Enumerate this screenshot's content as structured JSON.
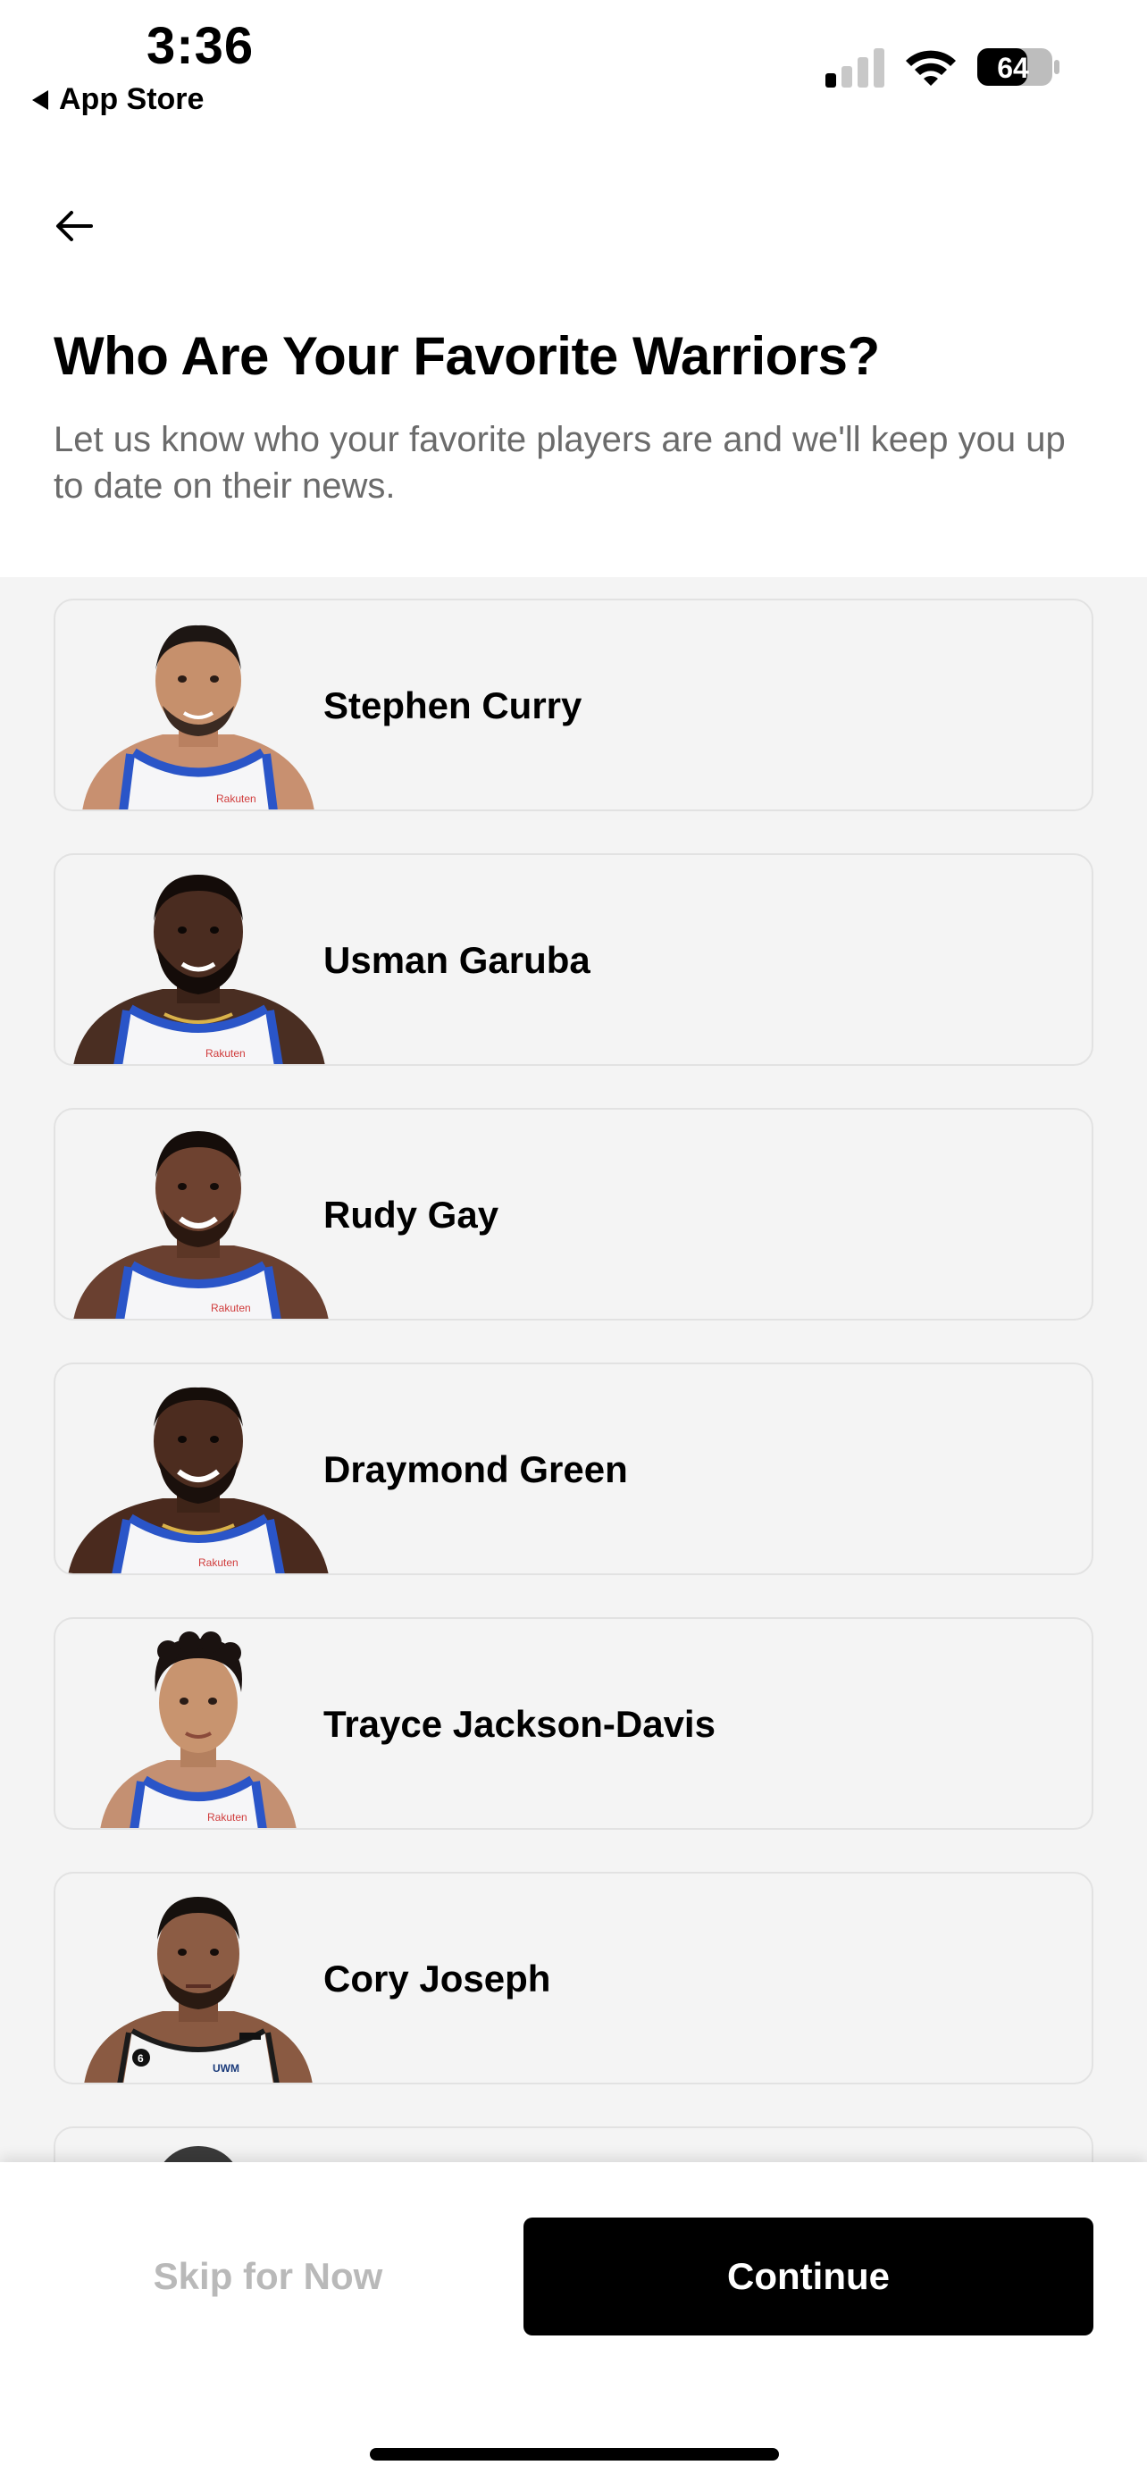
{
  "status_bar": {
    "time": "3:36",
    "back_app_label": "App Store",
    "battery_level": "64",
    "signal_bars_active": 1,
    "signal_bars_total": 4
  },
  "header": {
    "back_icon": "arrow-left-icon",
    "title": "Who Are Your Favorite Warriors?",
    "subtitle": "Let us know who your favorite players are and we'll keep you up to date on their news."
  },
  "players": [
    {
      "name": "Stephen Curry",
      "jersey": "white"
    },
    {
      "name": "Usman Garuba",
      "jersey": "white"
    },
    {
      "name": "Rudy Gay",
      "jersey": "white"
    },
    {
      "name": "Draymond Green",
      "jersey": "white"
    },
    {
      "name": "Trayce Jackson-Davis",
      "jersey": "white"
    },
    {
      "name": "Cory Joseph",
      "jersey": "white-black-trim"
    }
  ],
  "footer": {
    "skip_label": "Skip for Now",
    "continue_label": "Continue"
  },
  "colors": {
    "accent": "#000000",
    "list_background": "#f4f4f4",
    "card_border": "#e2e2e2",
    "subtitle_text": "#6b6b6b",
    "skip_text": "#b9b9b9",
    "jersey_blue": "#2a55c8"
  }
}
